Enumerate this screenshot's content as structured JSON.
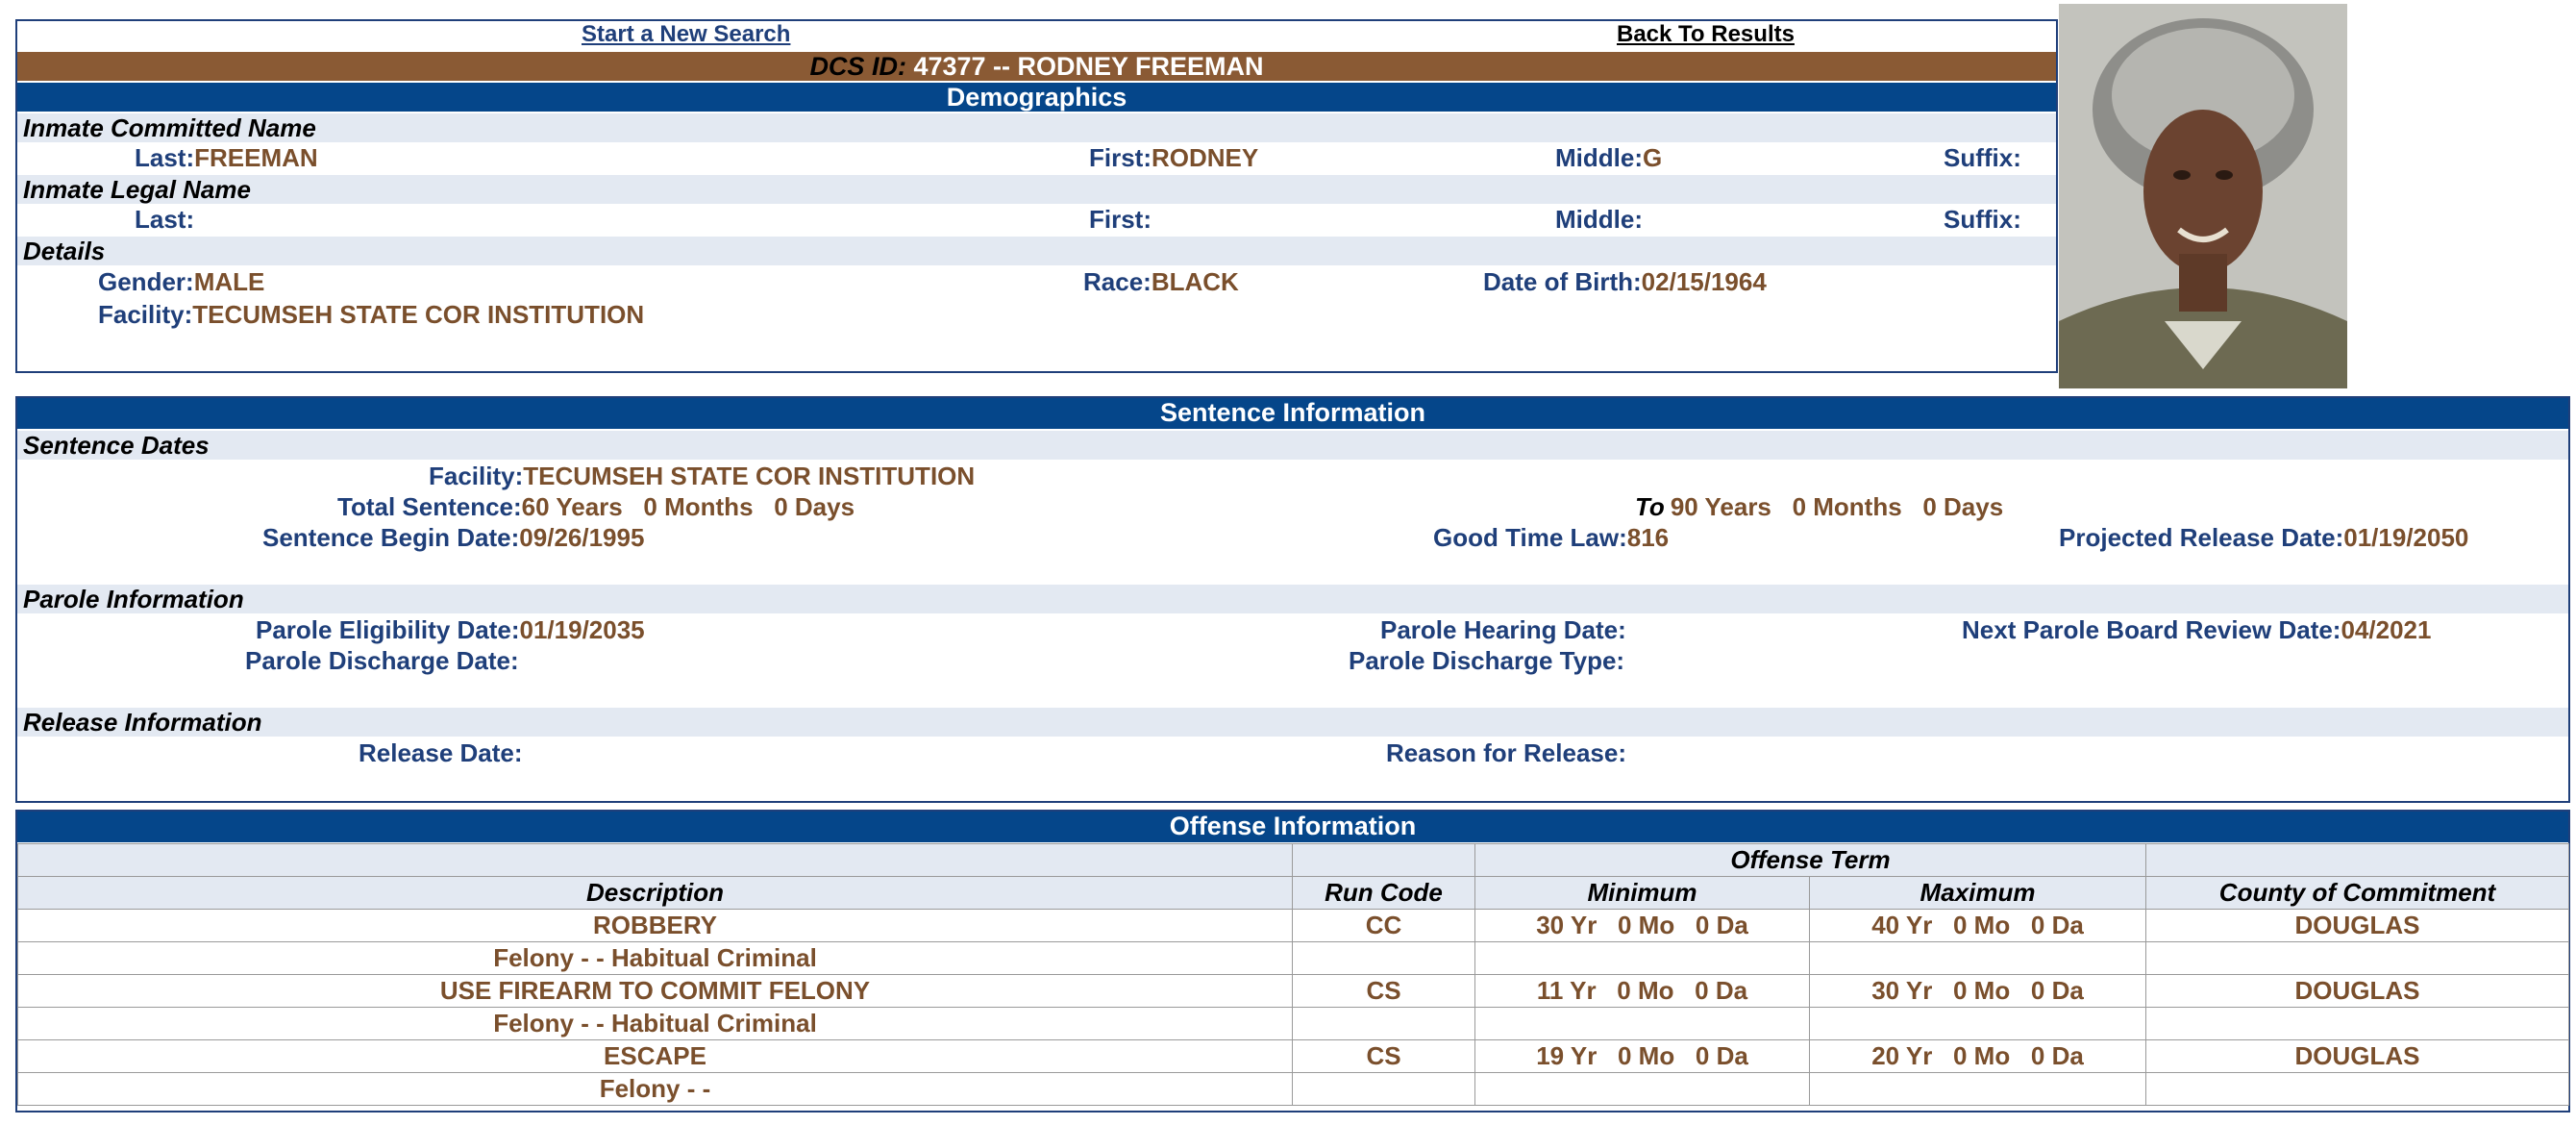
{
  "nav": {
    "new_search": "Start a New Search",
    "back_results": "Back To Results"
  },
  "header": {
    "dcs_label": "DCS ID:",
    "dcs_value": "47377 -- RODNEY FREEMAN"
  },
  "demographics": {
    "title": "Demographics",
    "committed_name": {
      "section": "Inmate Committed Name",
      "last_label": "Last:",
      "last": "FREEMAN",
      "first_label": "First:",
      "first": "RODNEY",
      "middle_label": "Middle:",
      "middle": "G",
      "suffix_label": "Suffix:",
      "suffix": ""
    },
    "legal_name": {
      "section": "Inmate Legal Name",
      "last_label": "Last:",
      "last": "",
      "first_label": "First:",
      "first": "",
      "middle_label": "Middle:",
      "middle": "",
      "suffix_label": "Suffix:",
      "suffix": ""
    },
    "details": {
      "section": "Details",
      "gender_label": "Gender:",
      "gender": "MALE",
      "race_label": "Race:",
      "race": "BLACK",
      "dob_label": "Date of Birth:",
      "dob": "02/15/1964",
      "facility_label": "Facility:",
      "facility": "TECUMSEH STATE COR INSTITUTION"
    }
  },
  "sentence": {
    "title": "Sentence Information",
    "dates_section": "Sentence Dates",
    "facility_label": "Facility:",
    "facility": "TECUMSEH STATE COR INSTITUTION",
    "total_label": "Total Sentence:",
    "total": "60 Years   0 Months   0 Days",
    "to_label": "To",
    "to_value": "90 Years   0 Months   0 Days",
    "begin_label": "Sentence Begin Date:",
    "begin": "09/26/1995",
    "good_time_label": "Good Time Law:",
    "good_time": "816",
    "projected_label": "Projected Release Date:",
    "projected": "01/19/2050",
    "parole_section": "Parole Information",
    "parole_elig_label": "Parole Eligibility Date:",
    "parole_elig": "01/19/2035",
    "parole_hearing_label": "Parole Hearing Date:",
    "parole_hearing": "",
    "next_review_label": "Next Parole Board Review Date:",
    "next_review": "04/2021",
    "parole_discharge_label": "Parole Discharge Date:",
    "parole_discharge": "",
    "parole_discharge_type_label": "Parole Discharge Type:",
    "parole_discharge_type": "",
    "release_section": "Release Information",
    "release_date_label": "Release Date:",
    "release_date": "",
    "release_reason_label": "Reason for Release:",
    "release_reason": ""
  },
  "offense": {
    "title": "Offense Information",
    "term_header": "Offense Term",
    "columns": {
      "description": "Description",
      "run_code": "Run Code",
      "minimum": "Minimum",
      "maximum": "Maximum",
      "county": "County of Commitment"
    },
    "rows": [
      {
        "description": "ROBBERY",
        "run_code": "CC",
        "minimum": "30 Yr   0 Mo   0 Da",
        "maximum": "40 Yr   0 Mo   0 Da",
        "county": "DOUGLAS",
        "class": "Felony - - Habitual Criminal"
      },
      {
        "description": "USE FIREARM TO COMMIT FELONY",
        "run_code": "CS",
        "minimum": "11 Yr   0 Mo   0 Da",
        "maximum": "30 Yr   0 Mo   0 Da",
        "county": "DOUGLAS",
        "class": "Felony - - Habitual Criminal"
      },
      {
        "description": "ESCAPE",
        "run_code": "CS",
        "minimum": "19 Yr   0 Mo   0 Da",
        "maximum": "20 Yr   0 Mo   0 Da",
        "county": "DOUGLAS",
        "class": "Felony - -"
      }
    ]
  }
}
